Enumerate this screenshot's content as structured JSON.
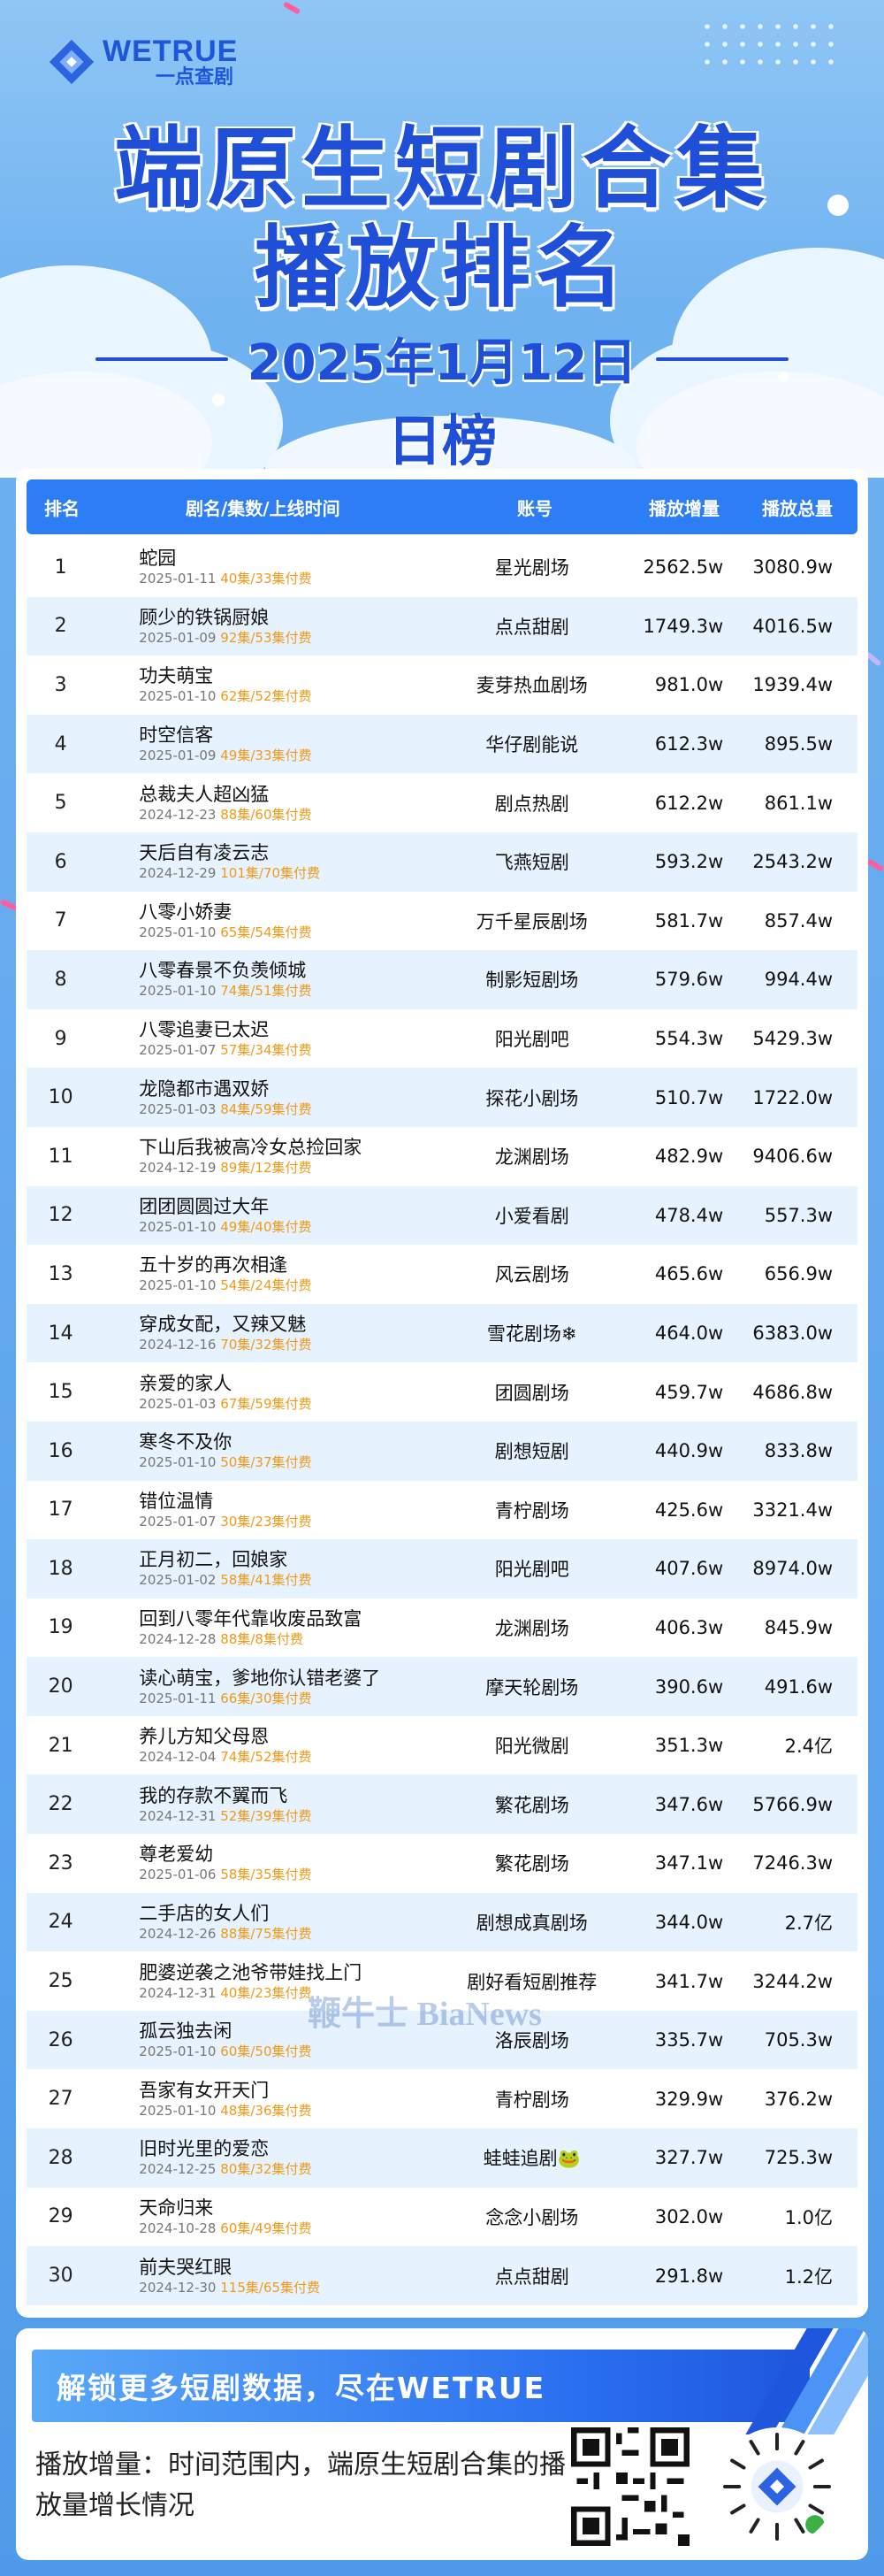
{
  "header": {
    "brand": "WETRUE",
    "brand_sub": "一点查剧",
    "title_line1": "端原生短剧合集",
    "title_line2": "播放排名",
    "date": "2025年1月12日",
    "board": "日榜"
  },
  "table": {
    "columns": [
      "排名",
      "剧名/集数/上线时间",
      "账号",
      "播放增量",
      "播放总量"
    ],
    "rows": [
      {
        "rank": "1",
        "name": "蛇园",
        "date": "2025-01-11",
        "episodes": "40集/33集付费",
        "account": "星光剧场",
        "increase": "2562.5w",
        "total": "3080.9w"
      },
      {
        "rank": "2",
        "name": "顾少的铁锅厨娘",
        "date": "2025-01-09",
        "episodes": "92集/53集付费",
        "account": "点点甜剧",
        "increase": "1749.3w",
        "total": "4016.5w"
      },
      {
        "rank": "3",
        "name": "功夫萌宝",
        "date": "2025-01-10",
        "episodes": "62集/52集付费",
        "account": "麦芽热血剧场",
        "increase": "981.0w",
        "total": "1939.4w"
      },
      {
        "rank": "4",
        "name": "时空信客",
        "date": "2025-01-09",
        "episodes": "49集/33集付费",
        "account": "华仔剧能说",
        "increase": "612.3w",
        "total": "895.5w"
      },
      {
        "rank": "5",
        "name": "总裁夫人超凶猛",
        "date": "2024-12-23",
        "episodes": "88集/60集付费",
        "account": "剧点热剧",
        "increase": "612.2w",
        "total": "861.1w"
      },
      {
        "rank": "6",
        "name": "天后自有凌云志",
        "date": "2024-12-29",
        "episodes": "101集/70集付费",
        "account": "飞燕短剧",
        "increase": "593.2w",
        "total": "2543.2w"
      },
      {
        "rank": "7",
        "name": "八零小娇妻",
        "date": "2025-01-10",
        "episodes": "65集/54集付费",
        "account": "万千星辰剧场",
        "increase": "581.7w",
        "total": "857.4w"
      },
      {
        "rank": "8",
        "name": "八零春景不负羡倾城",
        "date": "2025-01-10",
        "episodes": "74集/51集付费",
        "account": "制影短剧场",
        "increase": "579.6w",
        "total": "994.4w"
      },
      {
        "rank": "9",
        "name": "八零追妻已太迟",
        "date": "2025-01-07",
        "episodes": "57集/34集付费",
        "account": "阳光剧吧",
        "increase": "554.3w",
        "total": "5429.3w"
      },
      {
        "rank": "10",
        "name": "龙隐都市遇双娇",
        "date": "2025-01-03",
        "episodes": "84集/59集付费",
        "account": "探花小剧场",
        "increase": "510.7w",
        "total": "1722.0w"
      },
      {
        "rank": "11",
        "name": "下山后我被高冷女总捡回家",
        "date": "2024-12-19",
        "episodes": "89集/12集付费",
        "account": "龙渊剧场",
        "increase": "482.9w",
        "total": "9406.6w"
      },
      {
        "rank": "12",
        "name": "团团圆圆过大年",
        "date": "2025-01-10",
        "episodes": "49集/40集付费",
        "account": "小爱看剧",
        "increase": "478.4w",
        "total": "557.3w"
      },
      {
        "rank": "13",
        "name": "五十岁的再次相逢",
        "date": "2025-01-10",
        "episodes": "54集/24集付费",
        "account": "风云剧场",
        "increase": "465.6w",
        "total": "656.9w"
      },
      {
        "rank": "14",
        "name": "穿成女配，又辣又魅",
        "date": "2024-12-16",
        "episodes": "70集/32集付费",
        "account": "雪花剧场❄",
        "increase": "464.0w",
        "total": "6383.0w"
      },
      {
        "rank": "15",
        "name": "亲爱的家人",
        "date": "2025-01-03",
        "episodes": "67集/59集付费",
        "account": "团圆剧场",
        "increase": "459.7w",
        "total": "4686.8w"
      },
      {
        "rank": "16",
        "name": "寒冬不及你",
        "date": "2025-01-10",
        "episodes": "50集/37集付费",
        "account": "剧想短剧",
        "increase": "440.9w",
        "total": "833.8w"
      },
      {
        "rank": "17",
        "name": "错位温情",
        "date": "2025-01-07",
        "episodes": "30集/23集付费",
        "account": "青柠剧场",
        "increase": "425.6w",
        "total": "3321.4w"
      },
      {
        "rank": "18",
        "name": "正月初二，回娘家",
        "date": "2025-01-02",
        "episodes": "58集/41集付费",
        "account": "阳光剧吧",
        "increase": "407.6w",
        "total": "8974.0w"
      },
      {
        "rank": "19",
        "name": "回到八零年代靠收废品致富",
        "date": "2024-12-28",
        "episodes": "88集/8集付费",
        "account": "龙渊剧场",
        "increase": "406.3w",
        "total": "845.9w"
      },
      {
        "rank": "20",
        "name": "读心萌宝，爹地你认错老婆了",
        "date": "2025-01-11",
        "episodes": "66集/30集付费",
        "account": "摩天轮剧场",
        "increase": "390.6w",
        "total": "491.6w"
      },
      {
        "rank": "21",
        "name": "养儿方知父母恩",
        "date": "2024-12-04",
        "episodes": "74集/52集付费",
        "account": "阳光微剧",
        "increase": "351.3w",
        "total": "2.4亿"
      },
      {
        "rank": "22",
        "name": "我的存款不翼而飞",
        "date": "2024-12-31",
        "episodes": "52集/39集付费",
        "account": "繁花剧场",
        "increase": "347.6w",
        "total": "5766.9w"
      },
      {
        "rank": "23",
        "name": "尊老爱幼",
        "date": "2025-01-06",
        "episodes": "58集/35集付费",
        "account": "繁花剧场",
        "increase": "347.1w",
        "total": "7246.3w"
      },
      {
        "rank": "24",
        "name": "二手店的女人们",
        "date": "2024-12-26",
        "episodes": "88集/75集付费",
        "account": "剧想成真剧场",
        "increase": "344.0w",
        "total": "2.7亿"
      },
      {
        "rank": "25",
        "name": "肥婆逆袭之池爷带娃找上门",
        "date": "2024-12-31",
        "episodes": "40集/23集付费",
        "account": "剧好看短剧推荐",
        "increase": "341.7w",
        "total": "3244.2w"
      },
      {
        "rank": "26",
        "name": "孤云独去闲",
        "date": "2025-01-10",
        "episodes": "60集/50集付费",
        "account": "洛辰剧场",
        "increase": "335.7w",
        "total": "705.3w"
      },
      {
        "rank": "27",
        "name": "吾家有女开天门",
        "date": "2025-01-10",
        "episodes": "48集/36集付费",
        "account": "青柠剧场",
        "increase": "329.9w",
        "total": "376.2w"
      },
      {
        "rank": "28",
        "name": "旧时光里的爱恋",
        "date": "2024-12-25",
        "episodes": "80集/32集付费",
        "account": "蛙蛙追剧🐸",
        "increase": "327.7w",
        "total": "725.3w"
      },
      {
        "rank": "29",
        "name": "天命归来",
        "date": "2024-10-28",
        "episodes": "60集/49集付费",
        "account": "念念小剧场",
        "increase": "302.0w",
        "total": "1.0亿"
      },
      {
        "rank": "30",
        "name": "前夫哭红眼",
        "date": "2024-12-30",
        "episodes": "115集/65集付费",
        "account": "点点甜剧",
        "increase": "291.8w",
        "total": "1.2亿"
      }
    ]
  },
  "watermark": "鞭牛士 BiaNews",
  "footer": {
    "banner": "解锁更多短剧数据，尽在WETRUE",
    "note": "播放增量：时间范围内，端原生短剧合集的播放量增长情况"
  },
  "colors": {
    "primary": "#1e4fd6",
    "header_bar": "#2d7ef4",
    "episode_highlight": "#f09a1a",
    "row_alt": "#e6f2fd"
  }
}
